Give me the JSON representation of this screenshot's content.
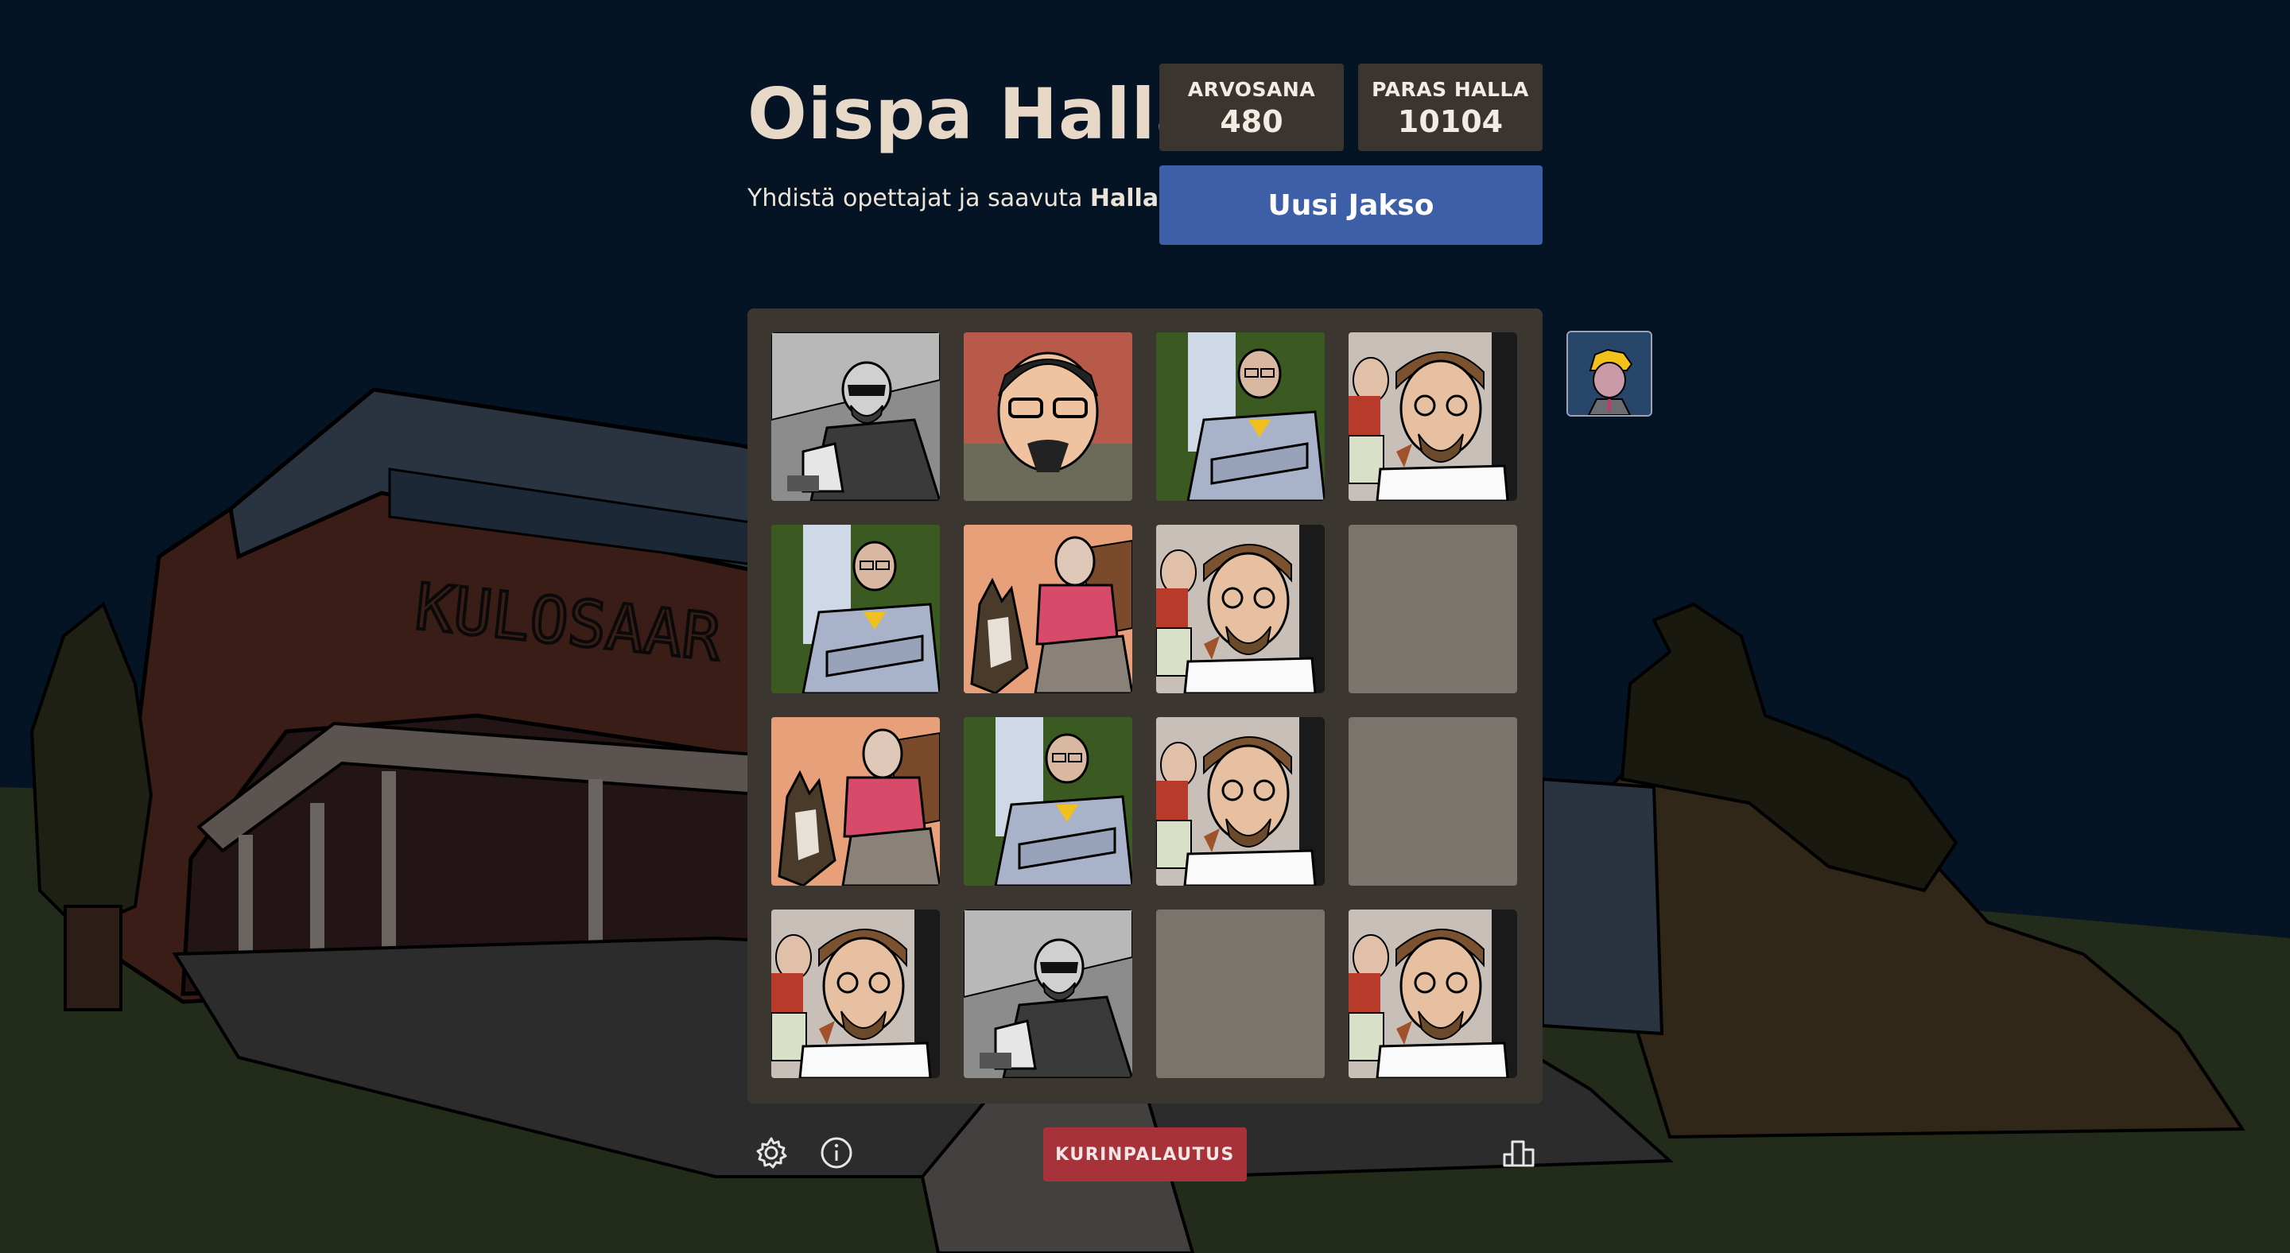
{
  "header": {
    "title": "Oispa Halla",
    "subtitle_prefix": "Yhdistä opettajat ja saavuta ",
    "subtitle_bold": "Halla!"
  },
  "scores": {
    "score_label": "ARVOSANA",
    "score_value": "480",
    "best_label": "PARAS HALLA",
    "best_value": "10104"
  },
  "actions": {
    "new_game_label": "Uusi Jakso",
    "discipline_label": "KURINPALAUTUS"
  },
  "background": {
    "school_sign": "KULOSAAR"
  },
  "board": {
    "size": 4,
    "tiles": [
      [
        "teacher-sunglasses",
        "teacher-goatee-red",
        "teacher-arms-crossed",
        "teacher-glasses-beard"
      ],
      [
        "teacher-arms-crossed",
        "teacher-with-cat",
        "teacher-glasses-beard",
        "empty"
      ],
      [
        "teacher-with-cat",
        "teacher-arms-crossed",
        "teacher-glasses-beard",
        "empty"
      ],
      [
        "teacher-glasses-beard",
        "teacher-sunglasses",
        "empty",
        "teacher-glasses-beard"
      ]
    ]
  },
  "side_preview": "teacher-yellow-hair",
  "footer_icons": [
    "gear-icon",
    "info-icon",
    "leaderboard-icon"
  ],
  "colors": {
    "sky": "#041424",
    "board": "#3b3630",
    "empty_tile": "#7a746d",
    "score_box": "#3b3530",
    "new_game_button": "#3d5fa8",
    "discipline_button": "#a8323a",
    "title": "#e8d8c8"
  }
}
